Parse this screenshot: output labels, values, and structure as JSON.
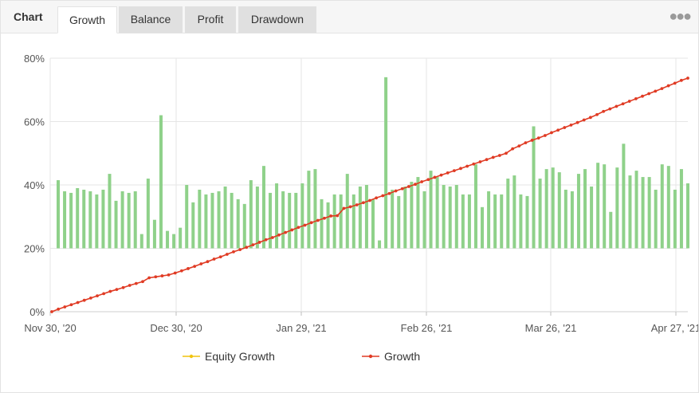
{
  "tabs": {
    "title": "Chart",
    "items": [
      {
        "label": "Growth",
        "active": true
      },
      {
        "label": "Balance",
        "active": false
      },
      {
        "label": "Profit",
        "active": false
      },
      {
        "label": "Drawdown",
        "active": false
      }
    ],
    "more_icon": "more-dots-icon"
  },
  "colors": {
    "growth": "#e03b24",
    "equity": "#f1c40f",
    "bars": "#8fd18a",
    "grid": "#e6e6e6",
    "axis": "#555555"
  },
  "chart_data": {
    "type": "line",
    "y_axis": {
      "ticks": [
        "0%",
        "20%",
        "40%",
        "60%",
        "80%"
      ],
      "min": 0,
      "max": 80,
      "unit": "%"
    },
    "x_axis": {
      "tick_labels": [
        "Nov 30, '20",
        "Dec 30, '20",
        "Jan 29, '21",
        "Feb 26, '21",
        "Mar 26, '21",
        "Apr 27, '21"
      ]
    },
    "legend": {
      "position": "bottom"
    },
    "series": [
      {
        "name": "Equity Growth",
        "color": "#f1c40f",
        "values": []
      },
      {
        "name": "Growth",
        "color": "#e03b24",
        "values": [
          0,
          0.8,
          1.5,
          2.2,
          2.9,
          3.6,
          4.3,
          5.0,
          5.7,
          6.4,
          7.0,
          7.6,
          8.3,
          8.9,
          9.5,
          10.7,
          11.0,
          11.3,
          11.6,
          12.2,
          12.9,
          13.6,
          14.3,
          15.1,
          15.8,
          16.6,
          17.3,
          18.1,
          18.9,
          19.6,
          20.3,
          21.1,
          21.9,
          22.7,
          23.4,
          24.2,
          25.0,
          25.8,
          26.6,
          27.3,
          28.1,
          28.8,
          29.5,
          30.2,
          30.3,
          32.6,
          33.1,
          33.7,
          34.4,
          35.1,
          35.9,
          36.6,
          37.3,
          38.1,
          38.8,
          39.5,
          40.2,
          41.0,
          41.7,
          42.4,
          43.1,
          43.8,
          44.5,
          45.2,
          45.9,
          46.6,
          47.3,
          48.0,
          48.7,
          49.3,
          50.0,
          51.4,
          52.3,
          53.3,
          54.1,
          54.8,
          55.6,
          56.5,
          57.3,
          58.1,
          58.9,
          59.7,
          60.5,
          61.3,
          62.2,
          63.2,
          64.0,
          64.8,
          65.6,
          66.4,
          67.2,
          68.0,
          68.8,
          69.6,
          70.4,
          71.3,
          72.1,
          73.0,
          73.7
        ]
      },
      {
        "name": "",
        "type": "bar",
        "color": "#8fd18a",
        "base": 20,
        "values": [
          41.5,
          38,
          37.5,
          39,
          38.5,
          38,
          37,
          38.5,
          43.5,
          35,
          38,
          37.5,
          38,
          24.5,
          42,
          29,
          62,
          25.5,
          24.5,
          26.5,
          40,
          34.5,
          38.5,
          37,
          37.5,
          38,
          39.5,
          37.5,
          35.5,
          34,
          41.5,
          39.5,
          46,
          37.5,
          40.5,
          38,
          37.5,
          37.5,
          40.5,
          44.5,
          45,
          35.5,
          34.5,
          37,
          37,
          43.5,
          37,
          39.5,
          40,
          35.5,
          22.5,
          74,
          38.5,
          36.5,
          39.5,
          41,
          42.5,
          38,
          44.5,
          42.5,
          40,
          39.5,
          40,
          37,
          37,
          46.5,
          33,
          38,
          37,
          37,
          42,
          43,
          37,
          36.5,
          58.5,
          42,
          45,
          45.5,
          44,
          38.5,
          38,
          43.5,
          45,
          39.5,
          47,
          46.5,
          31.5,
          45.5,
          53,
          43,
          44.5,
          42.5,
          42.5,
          38.5,
          46.5,
          46,
          38.5,
          45,
          40.5
        ]
      }
    ]
  },
  "legend_items": [
    {
      "label": "Equity Growth",
      "color": "#f1c40f",
      "icon": "legend-line-marker-icon"
    },
    {
      "label": "Growth",
      "color": "#e03b24",
      "icon": "legend-line-marker-icon"
    }
  ]
}
